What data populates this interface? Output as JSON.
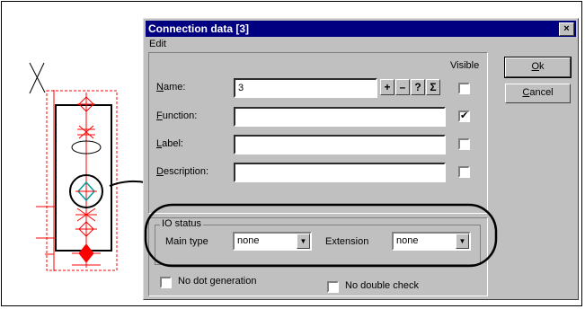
{
  "dialog": {
    "title": "Connection data [3]",
    "close_glyph": "×",
    "menu": [
      "Edit"
    ],
    "visible_header": "Visible",
    "rows": [
      {
        "label_underlined": "N",
        "label_rest": "ame:",
        "value": "3",
        "visible": false
      },
      {
        "label_underlined": "F",
        "label_rest": "unction:",
        "value": "",
        "visible": true
      },
      {
        "label_underlined": "L",
        "label_rest": "abel:",
        "value": "",
        "visible": false
      },
      {
        "label_underlined": "D",
        "label_rest": "escription:",
        "value": "",
        "visible": false
      }
    ],
    "name_buttons": [
      "+",
      "–",
      "?",
      "Σ"
    ],
    "ok_underlined": "O",
    "ok_rest": "k",
    "cancel_underlined": "C",
    "cancel_rest": "ancel",
    "io_status": {
      "group_label": "IO status",
      "main_type_label": "Main type",
      "main_type_value": "none",
      "extension_label": "Extension",
      "extension_value": "none"
    },
    "no_dot_generation": {
      "label": "No dot generation",
      "checked": false
    },
    "no_double_check": {
      "label": "No double check",
      "checked": false
    }
  },
  "colors": {
    "titlebar": "#000080",
    "symbol_red": "#ff0000",
    "dialog_bg": "#c0c0c0",
    "highlight": "#00a0a0"
  }
}
